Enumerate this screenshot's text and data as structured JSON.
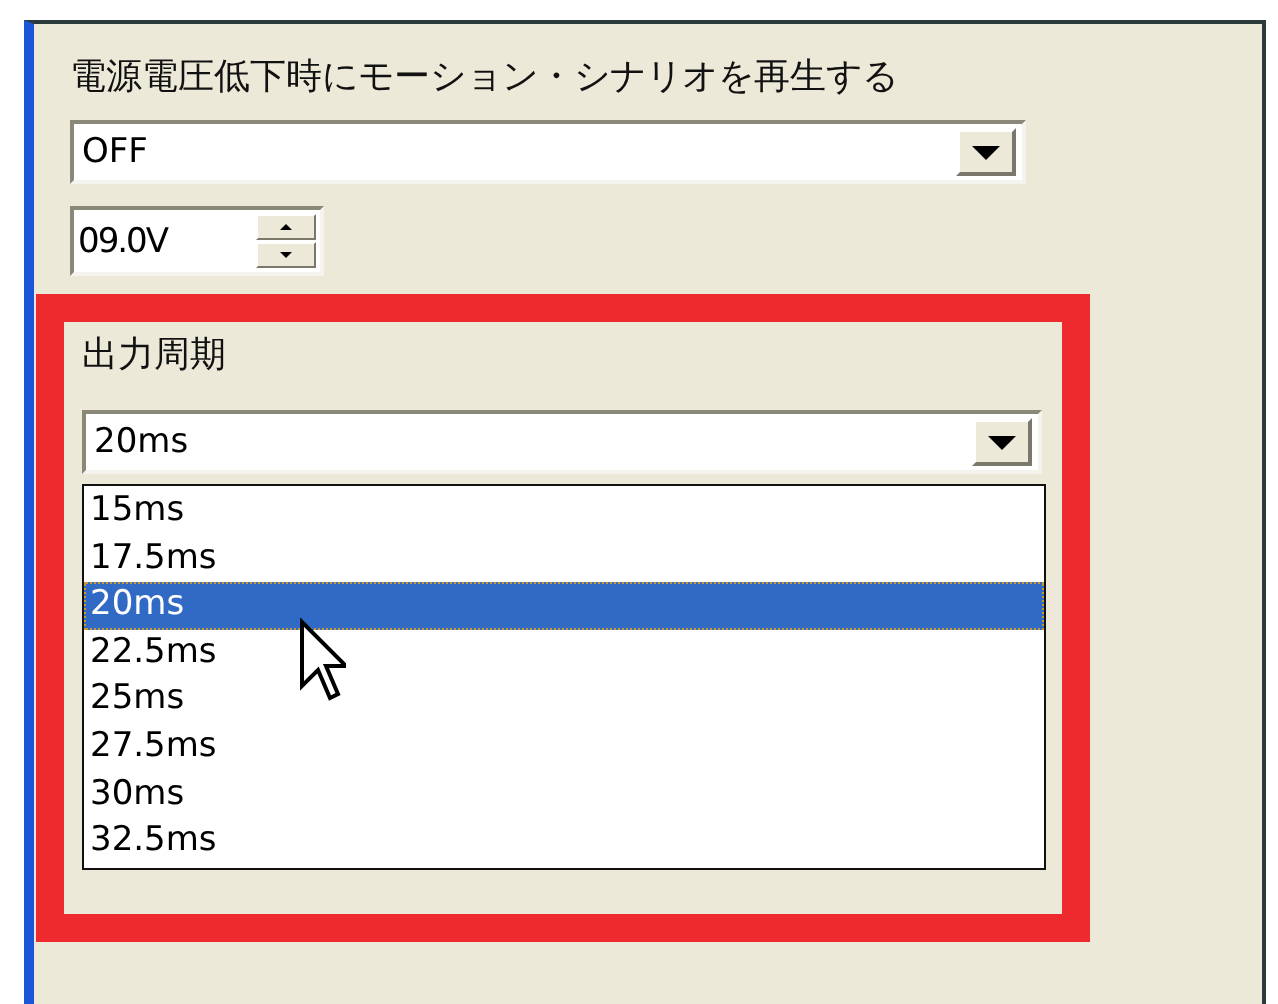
{
  "low_voltage": {
    "label": "電源電圧低下時にモーション・シナリオを再生する",
    "mode": "OFF",
    "voltage": "09.0V"
  },
  "output_period": {
    "label": "出力周期",
    "value": "20ms",
    "expanded": true,
    "highlighted": true,
    "options": [
      {
        "label": "15ms",
        "selected": false
      },
      {
        "label": "17.5ms",
        "selected": false
      },
      {
        "label": "20ms",
        "selected": true
      },
      {
        "label": "22.5ms",
        "selected": false
      },
      {
        "label": "25ms",
        "selected": false
      },
      {
        "label": "27.5ms",
        "selected": false
      },
      {
        "label": "30ms",
        "selected": false
      },
      {
        "label": "32.5ms",
        "selected": false
      }
    ]
  }
}
